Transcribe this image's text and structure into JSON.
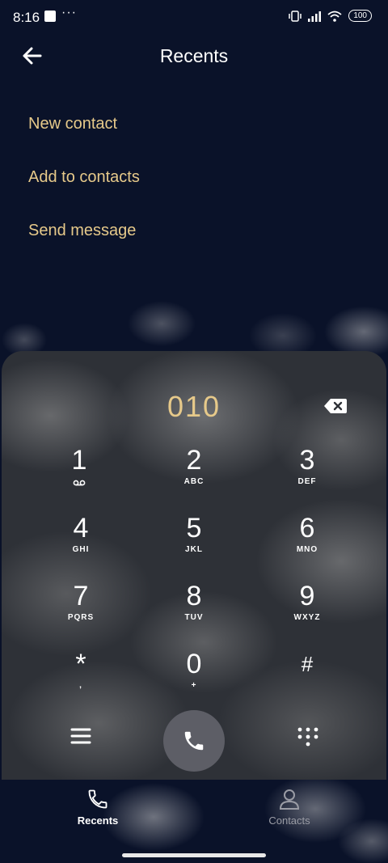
{
  "status_bar": {
    "time": "8:16",
    "dots": "···",
    "battery": "100"
  },
  "header": {
    "title": "Recents"
  },
  "menu": {
    "items": [
      {
        "label": "New contact"
      },
      {
        "label": "Add to contacts"
      },
      {
        "label": "Send message"
      }
    ]
  },
  "dialer": {
    "number": "010",
    "keys": [
      {
        "digit": "1",
        "letters": ""
      },
      {
        "digit": "2",
        "letters": "ABC"
      },
      {
        "digit": "3",
        "letters": "DEF"
      },
      {
        "digit": "4",
        "letters": "GHI"
      },
      {
        "digit": "5",
        "letters": "JKL"
      },
      {
        "digit": "6",
        "letters": "MNO"
      },
      {
        "digit": "7",
        "letters": "PQRS"
      },
      {
        "digit": "8",
        "letters": "TUV"
      },
      {
        "digit": "9",
        "letters": "WXYZ"
      },
      {
        "digit": "*",
        "letters": ","
      },
      {
        "digit": "0",
        "letters": "+"
      },
      {
        "digit": "#",
        "letters": ""
      }
    ]
  },
  "bottom_nav": {
    "tabs": [
      {
        "label": "Recents",
        "active": true
      },
      {
        "label": "Contacts",
        "active": false
      }
    ]
  },
  "colors": {
    "accent": "#e6c98a",
    "background": "#0a1229",
    "call_button": "#5d5e66"
  },
  "icons": [
    "back-arrow-icon",
    "backspace-icon",
    "voicemail-icon",
    "menu-icon",
    "phone-icon",
    "dialpad-icon",
    "contacts-icon",
    "vibrate-icon",
    "signal-icon",
    "wifi-icon",
    "battery-icon"
  ]
}
